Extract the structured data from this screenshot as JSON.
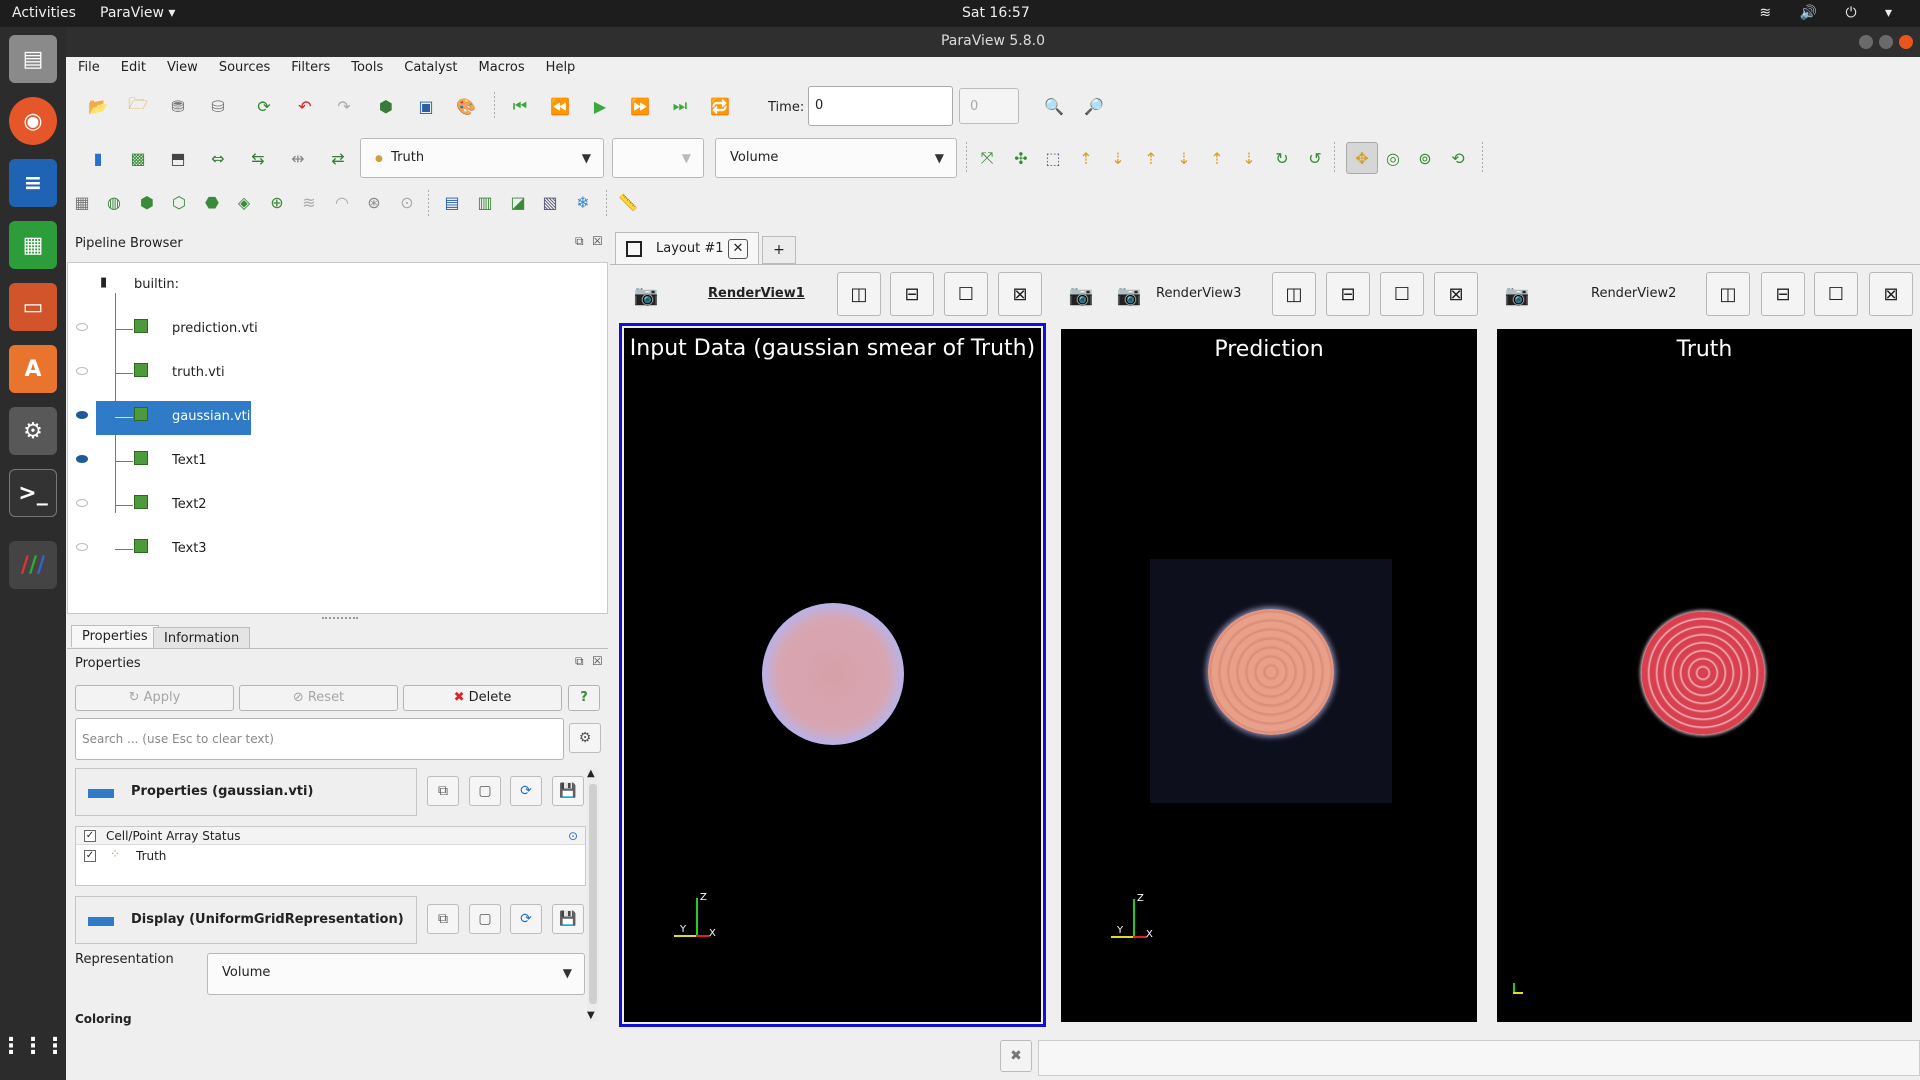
{
  "topbar": {
    "activities": "Activities",
    "app_menu": "ParaView ▾",
    "clock": "Sat 16:57",
    "tray": "≋ 🔊 ⏻ ▾"
  },
  "window": {
    "title": "ParaView 5.8.0"
  },
  "menu": [
    "File",
    "Edit",
    "View",
    "Sources",
    "Filters",
    "Tools",
    "Catalyst",
    "Macros",
    "Help"
  ],
  "time": {
    "label": "Time:",
    "value": "0",
    "step": "0"
  },
  "toolbar2": {
    "array_combo": "Truth",
    "component_combo": "",
    "representation_combo": "Volume"
  },
  "pipeline": {
    "title": "Pipeline Browser",
    "root": "builtin:",
    "items": [
      {
        "label": "prediction.vti",
        "visible": false
      },
      {
        "label": "truth.vti",
        "visible": false
      },
      {
        "label": "gaussian.vti",
        "visible": true,
        "selected": true
      },
      {
        "label": "Text1",
        "visible": true
      },
      {
        "label": "Text2",
        "visible": false
      },
      {
        "label": "Text3",
        "visible": false
      }
    ]
  },
  "tabs": {
    "properties": "Properties",
    "information": "Information"
  },
  "properties": {
    "title": "Properties",
    "apply": "Apply",
    "reset": "Reset",
    "delete": "Delete",
    "help": "?",
    "search_placeholder": "Search ... (use Esc to clear text)",
    "section1": "Properties (gaussian.vti)",
    "array_status_header": "Cell/Point Array Status",
    "array_item": "Truth",
    "section2": "Display (UniformGridRepresentation)",
    "representation_label": "Representation",
    "representation_value": "Volume",
    "coloring_label": "Coloring"
  },
  "layout": {
    "tab": "Layout #1",
    "add_tab": "+"
  },
  "views": [
    {
      "name": "RenderView1",
      "title": "Input Data (gaussian smear of Truth)"
    },
    {
      "name": "RenderView3",
      "title": "Prediction"
    },
    {
      "name": "RenderView2",
      "title": "Truth"
    }
  ],
  "axes": {
    "z": "Z",
    "y": "Y",
    "x": "X"
  }
}
